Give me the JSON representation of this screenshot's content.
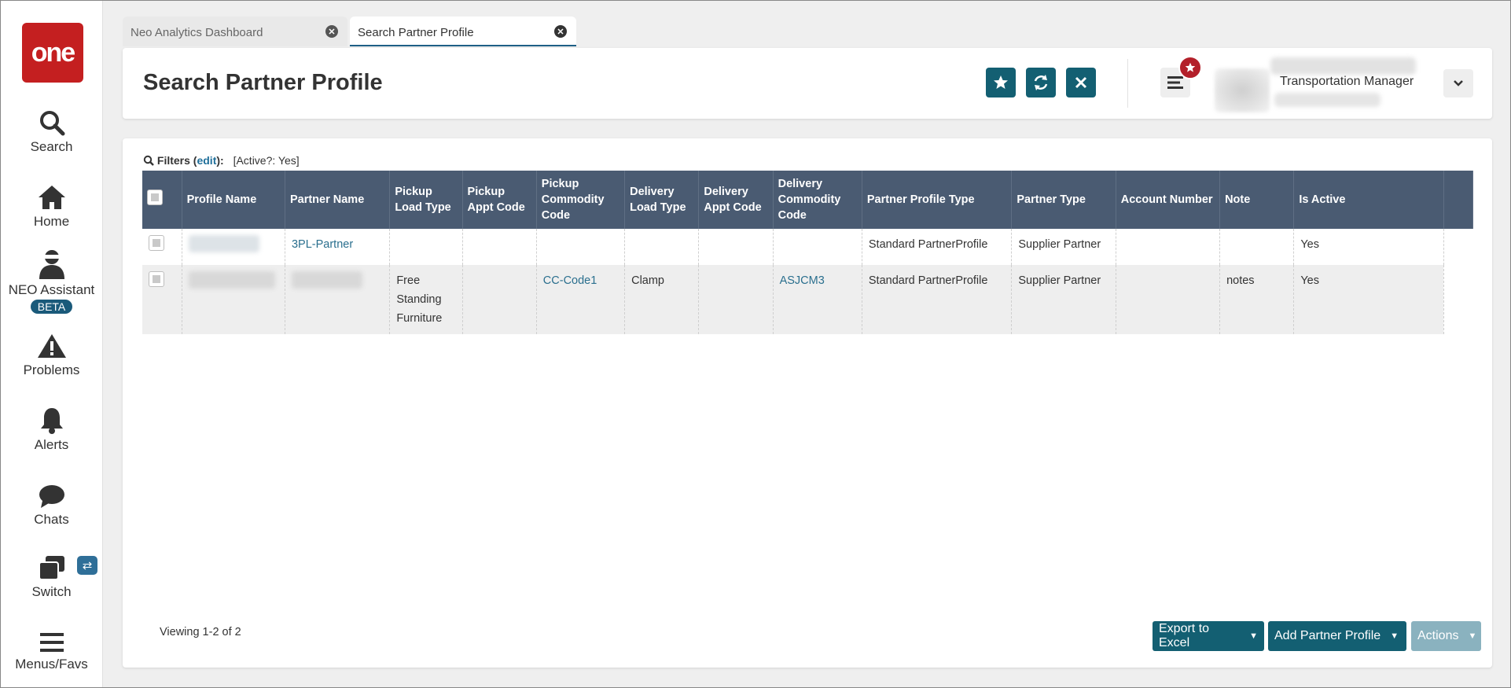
{
  "app": {
    "logo_text": "one",
    "brand_color": "#c41f20"
  },
  "sidebar": {
    "items": [
      {
        "label": "Search",
        "icon": "search-icon"
      },
      {
        "label": "Home",
        "icon": "home-icon"
      },
      {
        "label": "NEO Assistant",
        "icon": "assistant-icon",
        "badge": "BETA"
      },
      {
        "label": "Problems",
        "icon": "warning-icon"
      },
      {
        "label": "Alerts",
        "icon": "bell-icon"
      },
      {
        "label": "Chats",
        "icon": "chat-icon"
      },
      {
        "label": "Switch",
        "icon": "switch-icon"
      },
      {
        "label": "Menus/Favs",
        "icon": "menu-icon"
      }
    ]
  },
  "tabs": [
    {
      "label": "Neo Analytics Dashboard",
      "active": false
    },
    {
      "label": "Search Partner Profile",
      "active": true
    }
  ],
  "header": {
    "title": "Search Partner Profile",
    "user_role": "Transportation Manager",
    "action_color": "#135f72"
  },
  "filters": {
    "label": "Filters",
    "edit_label": "edit",
    "value": "[Active?: Yes]"
  },
  "table": {
    "columns": [
      "Profile Name",
      "Partner Name",
      "Pickup Load Type",
      "Pickup Appt Code",
      "Pickup Commodity Code",
      "Delivery Load Type",
      "Delivery Appt Code",
      "Delivery Commodity Code",
      "Partner Profile Type",
      "Partner Type",
      "Account Number",
      "Note",
      "Is Active"
    ],
    "rows": [
      {
        "profile_name": "",
        "partner_name": "3PL-Partner",
        "pickup_load_type": "",
        "pickup_appt_code": "",
        "pickup_commodity_code": "",
        "delivery_load_type": "",
        "delivery_appt_code": "",
        "delivery_commodity_code": "",
        "partner_profile_type": "Standard PartnerProfile",
        "partner_type": "Supplier Partner",
        "account_number": "",
        "note": "",
        "is_active": "Yes"
      },
      {
        "profile_name": "",
        "partner_name": "",
        "pickup_load_type": "Free Standing Furniture",
        "pickup_appt_code": "",
        "pickup_commodity_code": "CC-Code1",
        "delivery_load_type": "Clamp",
        "delivery_appt_code": "",
        "delivery_commodity_code": "ASJCM3",
        "partner_profile_type": "Standard PartnerProfile",
        "partner_type": "Supplier Partner",
        "account_number": "",
        "note": "notes",
        "is_active": "Yes"
      }
    ]
  },
  "footer": {
    "viewing": "Viewing 1-2 of 2",
    "export_label": "Export to Excel",
    "add_label": "Add Partner Profile",
    "actions_label": "Actions"
  }
}
